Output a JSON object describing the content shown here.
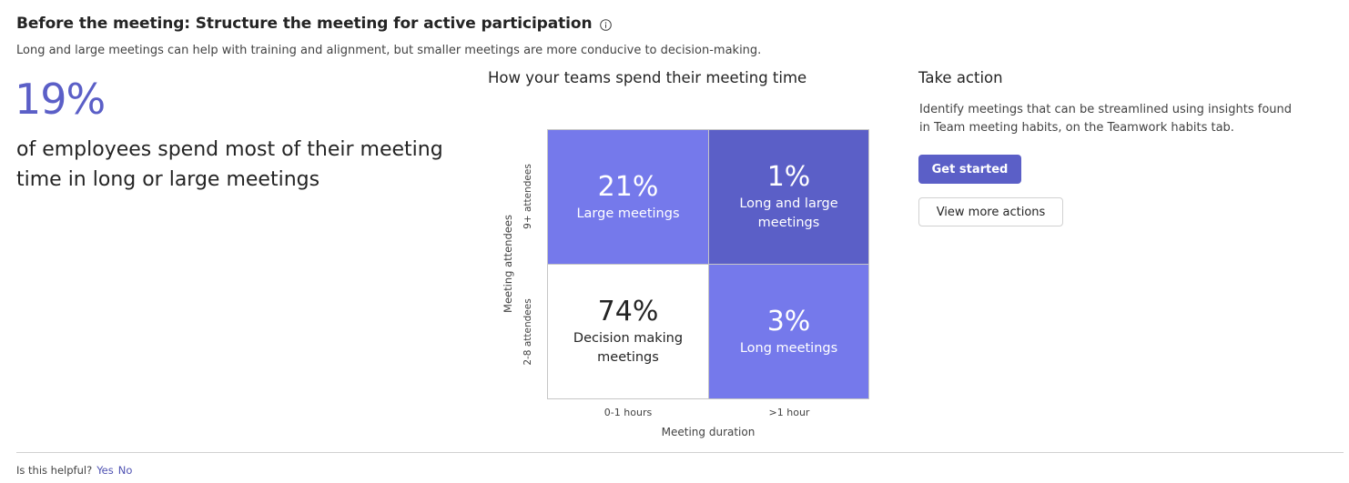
{
  "header": {
    "title": "Before the meeting: Structure the meeting for active participation",
    "info_icon": "info-icon",
    "subtitle": "Long and large meetings can help with training and alignment, but smaller meetings are more conducive to decision-making."
  },
  "summary": {
    "stat": "19%",
    "description": "of employees spend most of their meeting time in long or large meetings"
  },
  "chart": {
    "title": "How your teams spend their meeting time",
    "y_axis_title": "Meeting attendees",
    "y_ticks": [
      "9+ attendees",
      "2-8 attendees"
    ],
    "x_axis_title": "Meeting duration",
    "x_ticks": [
      "0-1 hours",
      ">1 hour"
    ],
    "cells": [
      {
        "value": "21%",
        "label": "Large meetings"
      },
      {
        "value": "1%",
        "label": "Long and large meetings"
      },
      {
        "value": "74%",
        "label": "Decision making meetings"
      },
      {
        "value": "3%",
        "label": "Long meetings"
      }
    ],
    "colors": {
      "light_purple": "#7579eb",
      "dark_purple": "#5b5fc7",
      "white": "#ffffff"
    }
  },
  "chart_data": {
    "type": "heatmap",
    "title": "How your teams spend their meeting time",
    "xlabel": "Meeting duration",
    "ylabel": "Meeting attendees",
    "x_categories": [
      "0-1 hours",
      ">1 hour"
    ],
    "y_categories": [
      "9+ attendees",
      "2-8 attendees"
    ],
    "values": [
      [
        21,
        1
      ],
      [
        74,
        3
      ]
    ],
    "cell_labels": [
      [
        "Large meetings",
        "Long and large meetings"
      ],
      [
        "Decision making meetings",
        "Long meetings"
      ]
    ],
    "unit": "%"
  },
  "action": {
    "title": "Take action",
    "description": "Identify meetings that can be streamlined using insights found in Team meeting habits, on the Teamwork habits tab.",
    "primary_button": "Get started",
    "secondary_button": "View more actions"
  },
  "feedback": {
    "prompt": "Is this helpful?",
    "yes": "Yes",
    "no": "No"
  }
}
